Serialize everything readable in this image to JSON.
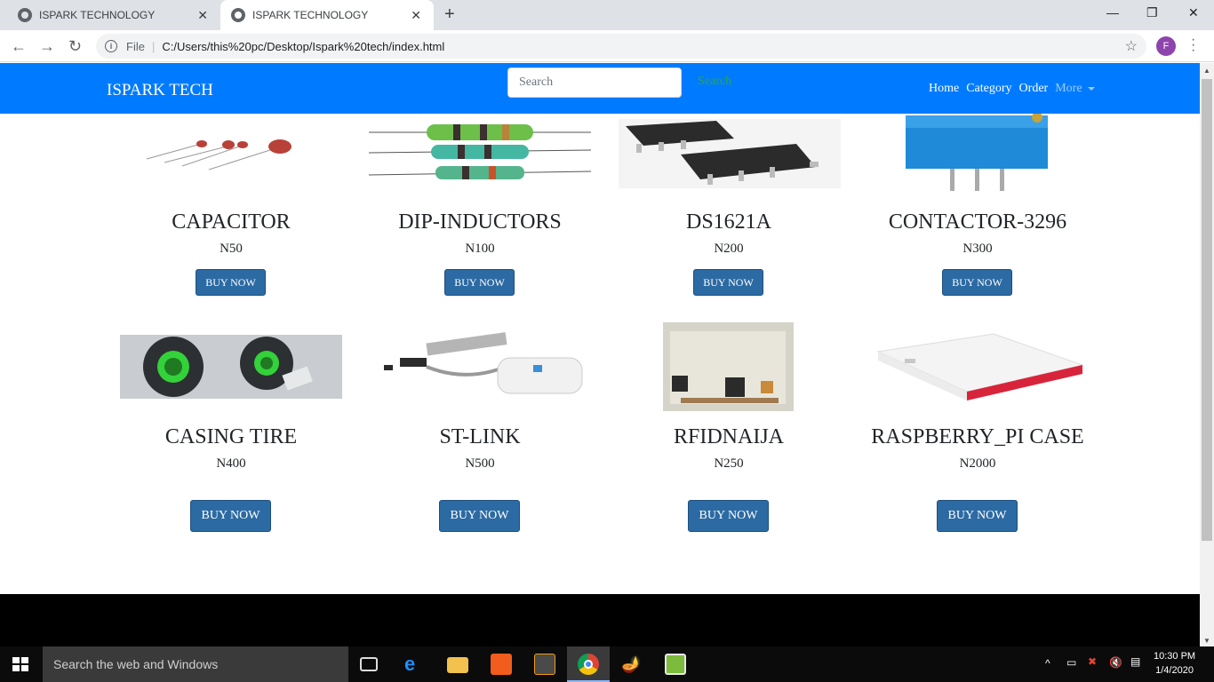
{
  "browser": {
    "tabs": [
      {
        "title": "ISPARK TECHNOLOGY",
        "active": false
      },
      {
        "title": "ISPARK TECHNOLOGY",
        "active": true
      }
    ],
    "new_tab": "+",
    "address": {
      "scheme_label": "File",
      "url": "C:/Users/this%20pc/Desktop/Ispark%20tech/index.html"
    },
    "profile_initial": "F"
  },
  "navbar": {
    "brand": "ISPARK TECH",
    "search_placeholder": "Search",
    "search_button": "Search",
    "links": [
      "Home",
      "Category",
      "Order"
    ],
    "more": "More",
    "color": "#007bff"
  },
  "products": [
    {
      "name": "CAPACITOR",
      "price": "N50",
      "button": "BUY NOW"
    },
    {
      "name": "DIP-INDUCTORS",
      "price": "N100",
      "button": "BUY NOW"
    },
    {
      "name": "DS1621A",
      "price": "N200",
      "button": "BUY NOW"
    },
    {
      "name": "CONTACTOR-3296",
      "price": "N300",
      "button": "BUY NOW"
    },
    {
      "name": "CASING TIRE",
      "price": "N400",
      "button": "BUY NOW"
    },
    {
      "name": "ST-LINK",
      "price": "N500",
      "button": "BUY NOW"
    },
    {
      "name": "RFIDNAIJA",
      "price": "N250",
      "button": "BUY NOW"
    },
    {
      "name": "RASPBERRY_PI CASE",
      "price": "N2000",
      "button": "BUY NOW"
    }
  ],
  "taskbar": {
    "search_placeholder": "Search the web and Windows",
    "time": "10:30 PM",
    "date": "1/4/2020"
  }
}
